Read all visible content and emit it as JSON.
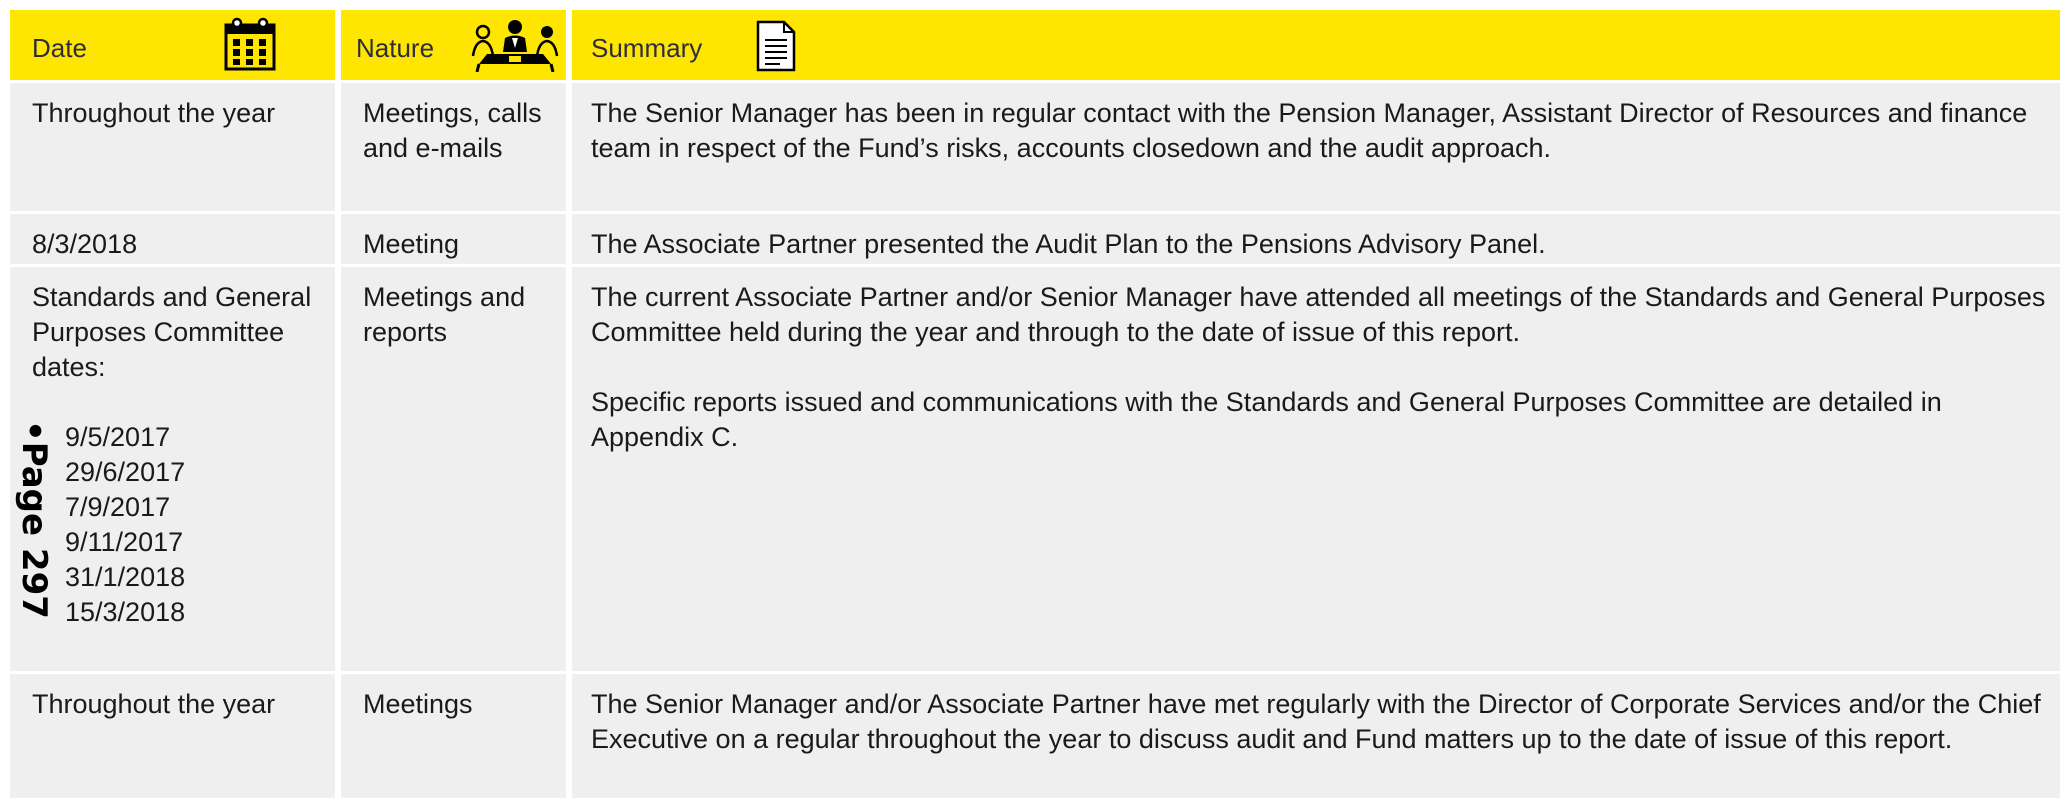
{
  "headers": {
    "date": "Date",
    "nature": "Nature",
    "summary": "Summary"
  },
  "icons": {
    "date": "calendar-icon",
    "nature": "meeting-icon",
    "summary": "document-icon"
  },
  "rows": [
    {
      "date": "Throughout the year",
      "nature": "Meetings, calls and e-mails",
      "summary": [
        "The Senior Manager has been in regular contact with the Pension Manager, Assistant Director of Resources and finance team in respect of the Fund’s risks, accounts closedown and the audit approach."
      ]
    },
    {
      "date": "8/3/2018",
      "nature": "Meeting",
      "summary": [
        "The Associate Partner presented the Audit Plan to the Pensions Advisory Panel."
      ]
    },
    {
      "date": "Standards and General Purposes Committee dates:",
      "dates": [
        "9/5/2017",
        "29/6/2017",
        "7/9/2017",
        "9/11/2017",
        "31/1/2018",
        "15/3/2018"
      ],
      "nature": "Meetings and reports",
      "summary": [
        "The current Associate Partner and/or Senior Manager have attended all meetings of the Standards and General Purposes Committee held during the year and through to the date of issue of this report.",
        "Specific reports issued and communications with the Standards and General Purposes Committee are detailed in Appendix C."
      ]
    },
    {
      "date": "Throughout the year",
      "nature": "Meetings",
      "summary": [
        "The Senior Manager and/or Associate Partner have met regularly with the Director of Corporate Services and/or the Chief Executive on a regular throughout the year to discuss audit and Fund matters up to the date of issue of this report."
      ]
    }
  ],
  "page_stamp": "•Page 297",
  "colors": {
    "header": "#ffe600",
    "cell": "#efefef",
    "text": "#1a1a1a"
  }
}
